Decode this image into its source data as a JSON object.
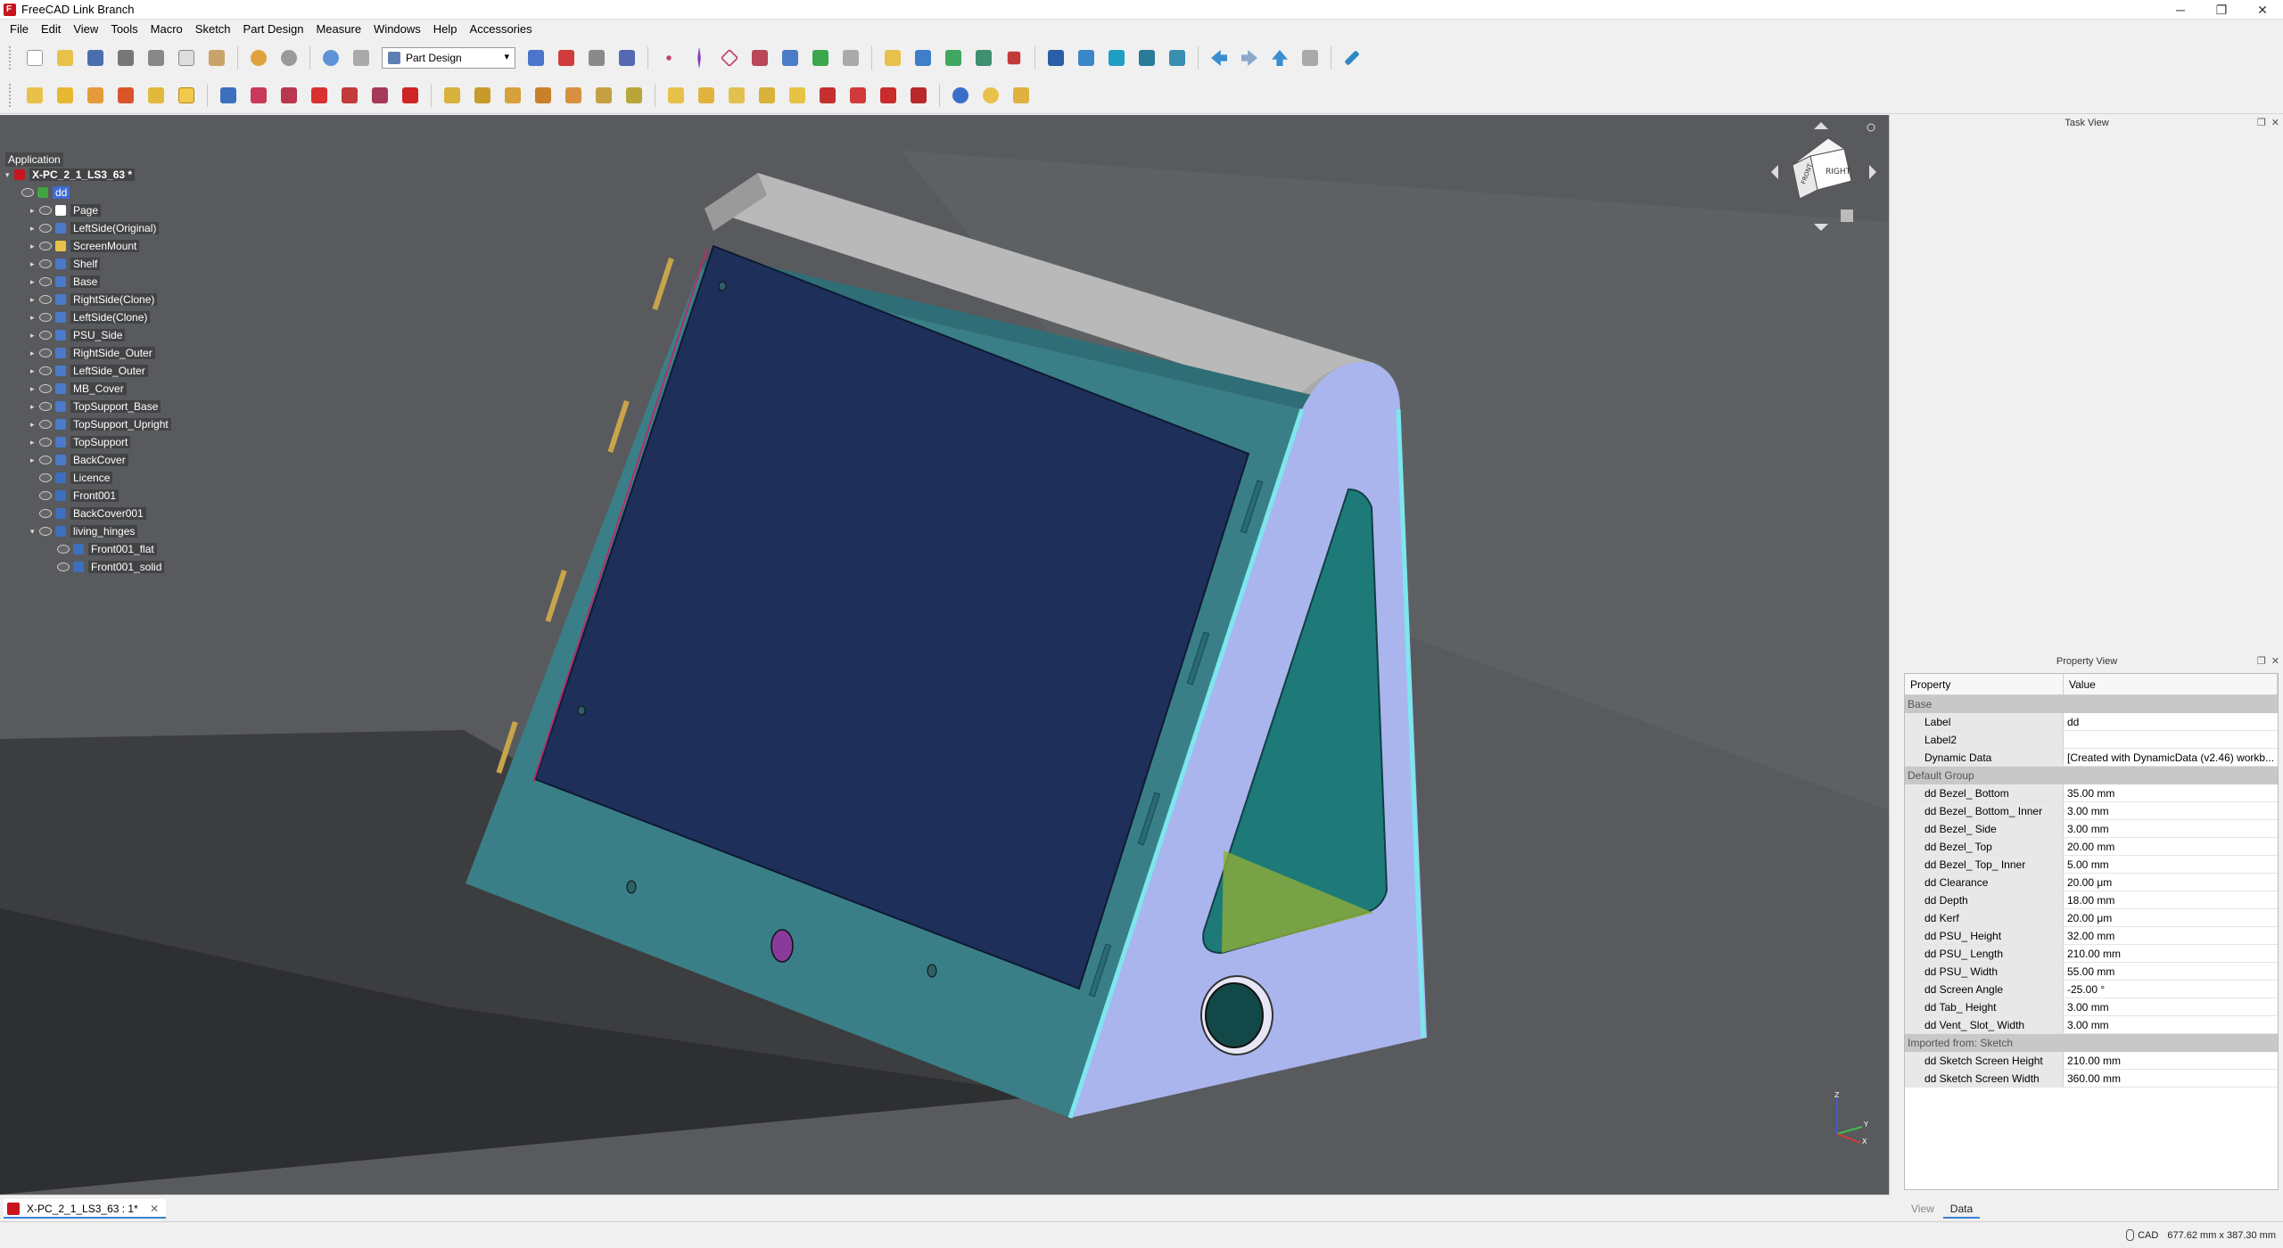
{
  "window": {
    "title": "FreeCAD Link Branch",
    "controls": [
      "─",
      "❐",
      "✕"
    ]
  },
  "menu": [
    "File",
    "Edit",
    "View",
    "Tools",
    "Macro",
    "Sketch",
    "Part Design",
    "Measure",
    "Windows",
    "Help",
    "Accessories"
  ],
  "toolbar": {
    "workbench": "Part Design"
  },
  "tree": {
    "header": "Application",
    "document": "X-PC_2_1_LS3_63 *",
    "items": [
      {
        "label": "dd"
      },
      {
        "label": "Page"
      },
      {
        "label": "LeftSide(Original)"
      },
      {
        "label": "ScreenMount"
      },
      {
        "label": "Shelf"
      },
      {
        "label": "Base"
      },
      {
        "label": "RightSide(Clone)"
      },
      {
        "label": "LeftSide(Clone)"
      },
      {
        "label": "PSU_Side"
      },
      {
        "label": "RightSide_Outer"
      },
      {
        "label": "LeftSide_Outer"
      },
      {
        "label": "MB_Cover"
      },
      {
        "label": "TopSupport_Base"
      },
      {
        "label": "TopSupport_Upright"
      },
      {
        "label": "TopSupport"
      },
      {
        "label": "BackCover"
      },
      {
        "label": "Licence"
      },
      {
        "label": "Front001"
      },
      {
        "label": "BackCover001"
      },
      {
        "label": "living_hinges"
      },
      {
        "label": "Front001_flat"
      },
      {
        "label": "Front001_solid"
      }
    ]
  },
  "navcube": {
    "front": "FRONT",
    "right": "RIGHT"
  },
  "axis": {
    "x": "X",
    "y": "Y",
    "z": "Z"
  },
  "taskview": {
    "title": "Task View"
  },
  "propview": {
    "title": "Property View",
    "col_property": "Property",
    "col_value": "Value",
    "groups": {
      "base": "Base",
      "default": "Default Group",
      "imported": "Imported from: Sketch"
    },
    "base": [
      {
        "name": "Label",
        "value": "dd"
      },
      {
        "name": "Label2",
        "value": ""
      },
      {
        "name": "Dynamic Data",
        "value": "[Created with DynamicData (v2.46) workb..."
      }
    ],
    "default": [
      {
        "name": "dd Bezel_ Bottom",
        "value": "35.00 mm"
      },
      {
        "name": "dd Bezel_ Bottom_ Inner",
        "value": "3.00 mm"
      },
      {
        "name": "dd Bezel_ Side",
        "value": "3.00 mm"
      },
      {
        "name": "dd Bezel_ Top",
        "value": "20.00 mm"
      },
      {
        "name": "dd Bezel_ Top_ Inner",
        "value": "5.00 mm"
      },
      {
        "name": "dd Clearance",
        "value": "20.00 μm"
      },
      {
        "name": "dd Depth",
        "value": "18.00 mm"
      },
      {
        "name": "dd Kerf",
        "value": "20.00 μm"
      },
      {
        "name": "dd PSU_ Height",
        "value": "32.00 mm"
      },
      {
        "name": "dd PSU_ Length",
        "value": "210.00 mm"
      },
      {
        "name": "dd PSU_ Width",
        "value": "55.00 mm"
      },
      {
        "name": "dd Screen Angle",
        "value": "-25.00 °"
      },
      {
        "name": "dd Tab_ Height",
        "value": "3.00 mm"
      },
      {
        "name": "dd Vent_ Slot_ Width",
        "value": "3.00 mm"
      }
    ],
    "imported": [
      {
        "name": "dd Sketch Screen Height",
        "value": "210.00 mm"
      },
      {
        "name": "dd Sketch Screen Width",
        "value": "360.00 mm"
      }
    ],
    "tabs": [
      "View",
      "Data"
    ]
  },
  "doc_tab": {
    "label": "X-PC_2_1_LS3_63 : 1*",
    "close": "✕"
  },
  "status": {
    "nav": "CAD",
    "dimensions": "677.62 mm x 387.30 mm"
  },
  "colors": {
    "selection": "#3d6bd6",
    "frame": "#3a7f87",
    "screen": "#1e2f5a",
    "side": "#aab5ee",
    "accent": "#3c7fd8"
  }
}
